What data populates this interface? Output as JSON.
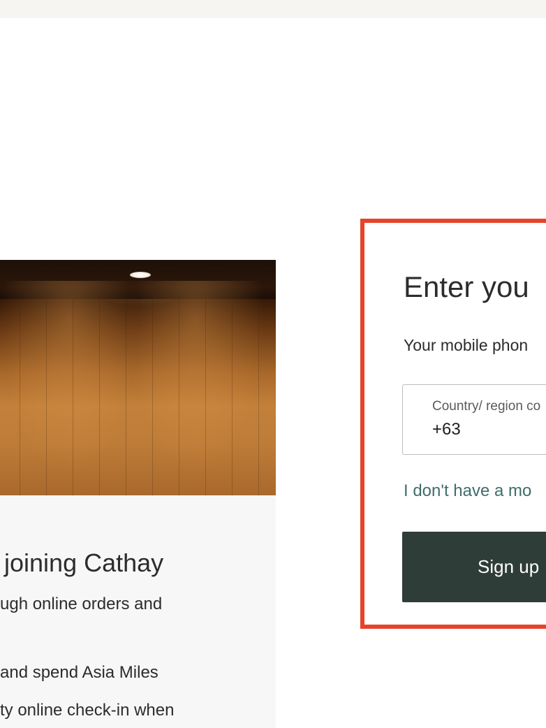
{
  "benefits": {
    "title": "f joining Cathay",
    "lines": [
      "ugh online orders and",
      "and spend Asia Miles",
      "ty online check-in when"
    ]
  },
  "signup": {
    "title": "Enter you",
    "subtitle": "Your mobile phon",
    "country_field": {
      "label": "Country/ region co",
      "value": "+63"
    },
    "no_mobile_link": "I don't have a mo",
    "submit_label": "Sign up"
  },
  "colors": {
    "highlight_border": "#e6432a",
    "button_bg": "#2f3d38",
    "link": "#3f6d6b"
  }
}
